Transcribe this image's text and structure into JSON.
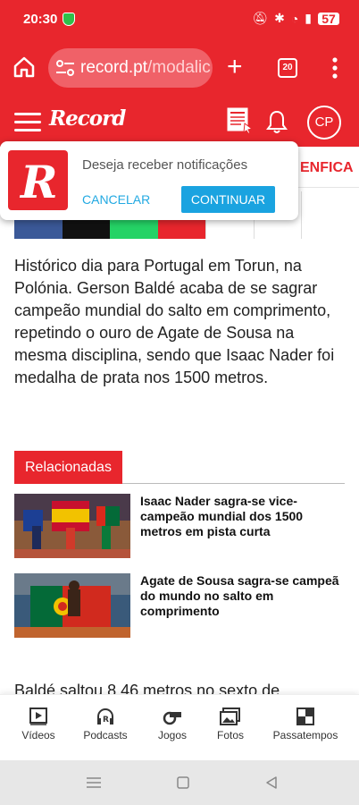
{
  "status_bar": {
    "time": "20:30",
    "battery": "57"
  },
  "browser": {
    "url_domain": "record.pt",
    "url_path": "/modalic",
    "tab_count": "20"
  },
  "header": {
    "logo_text": "Record",
    "avatar_initials": "CP"
  },
  "club_nav": {
    "visible_label": "ENFICA"
  },
  "notification": {
    "message": "Deseja receber notificações",
    "cancel_label": "CANCELAR",
    "continue_label": "CONTINUAR"
  },
  "share_colors": [
    "#3b5998",
    "#111111",
    "#25d366",
    "#e8262d"
  ],
  "article": {
    "paragraph": "Histórico dia para Portugal em Torun, na Polónia. Gerson Baldé acaba de se sagrar campeão mundial do salto em comprimento, repetindo o ouro de Agate de Sousa na mesma disciplina, sendo que Isaac Nader foi medalha de prata nos 1500 metros.",
    "next_paragraph": "Baldé saltou 8,46 metros no sexto de"
  },
  "related": {
    "title": "Relacionadas",
    "items": [
      {
        "headline": "Isaac Nader sagra-se vice-campeão mundial dos 1500 metros em pista curta"
      },
      {
        "headline": "Agate de Sousa sagra-se campeã do mundo no salto em comprimento"
      }
    ]
  },
  "bottom_nav": {
    "items": [
      {
        "label": "Vídeos",
        "icon": "video-icon"
      },
      {
        "label": "Podcasts",
        "icon": "headphones-icon"
      },
      {
        "label": "Jogos",
        "icon": "whistle-icon"
      },
      {
        "label": "Fotos",
        "icon": "photos-icon"
      },
      {
        "label": "Passatempos",
        "icon": "puzzle-icon"
      }
    ]
  },
  "colors": {
    "brand": "#e8262d",
    "link_blue": "#1aa3e0"
  }
}
